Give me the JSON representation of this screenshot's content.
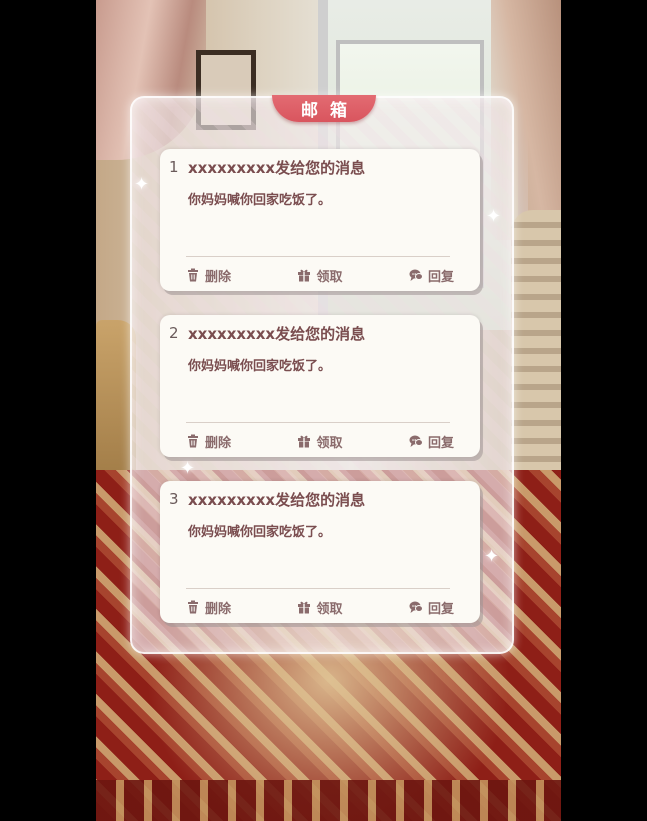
{
  "mailbox": {
    "title": "邮箱",
    "messages": [
      {
        "number": "1",
        "sender": "xxxxxxxxx发给您的消息",
        "body": "你妈妈喊你回家吃饭了。",
        "actions": {
          "delete": "删除",
          "claim": "领取",
          "reply": "回复"
        }
      },
      {
        "number": "2",
        "sender": "xxxxxxxxx发给您的消息",
        "body": "你妈妈喊你回家吃饭了。",
        "actions": {
          "delete": "删除",
          "claim": "领取",
          "reply": "回复"
        }
      },
      {
        "number": "3",
        "sender": "xxxxxxxxx发给您的消息",
        "body": "你妈妈喊你回家吃饭了。",
        "actions": {
          "delete": "删除",
          "claim": "领取",
          "reply": "回复"
        }
      }
    ]
  },
  "icons": {
    "delete": "trash-icon",
    "claim": "gift-icon",
    "reply": "chat-bubble-icon"
  },
  "colors": {
    "accent": "#d9555e",
    "text": "#7a4d4f",
    "action_text": "#8a6b6c",
    "card_background": "#fcfaf5"
  }
}
